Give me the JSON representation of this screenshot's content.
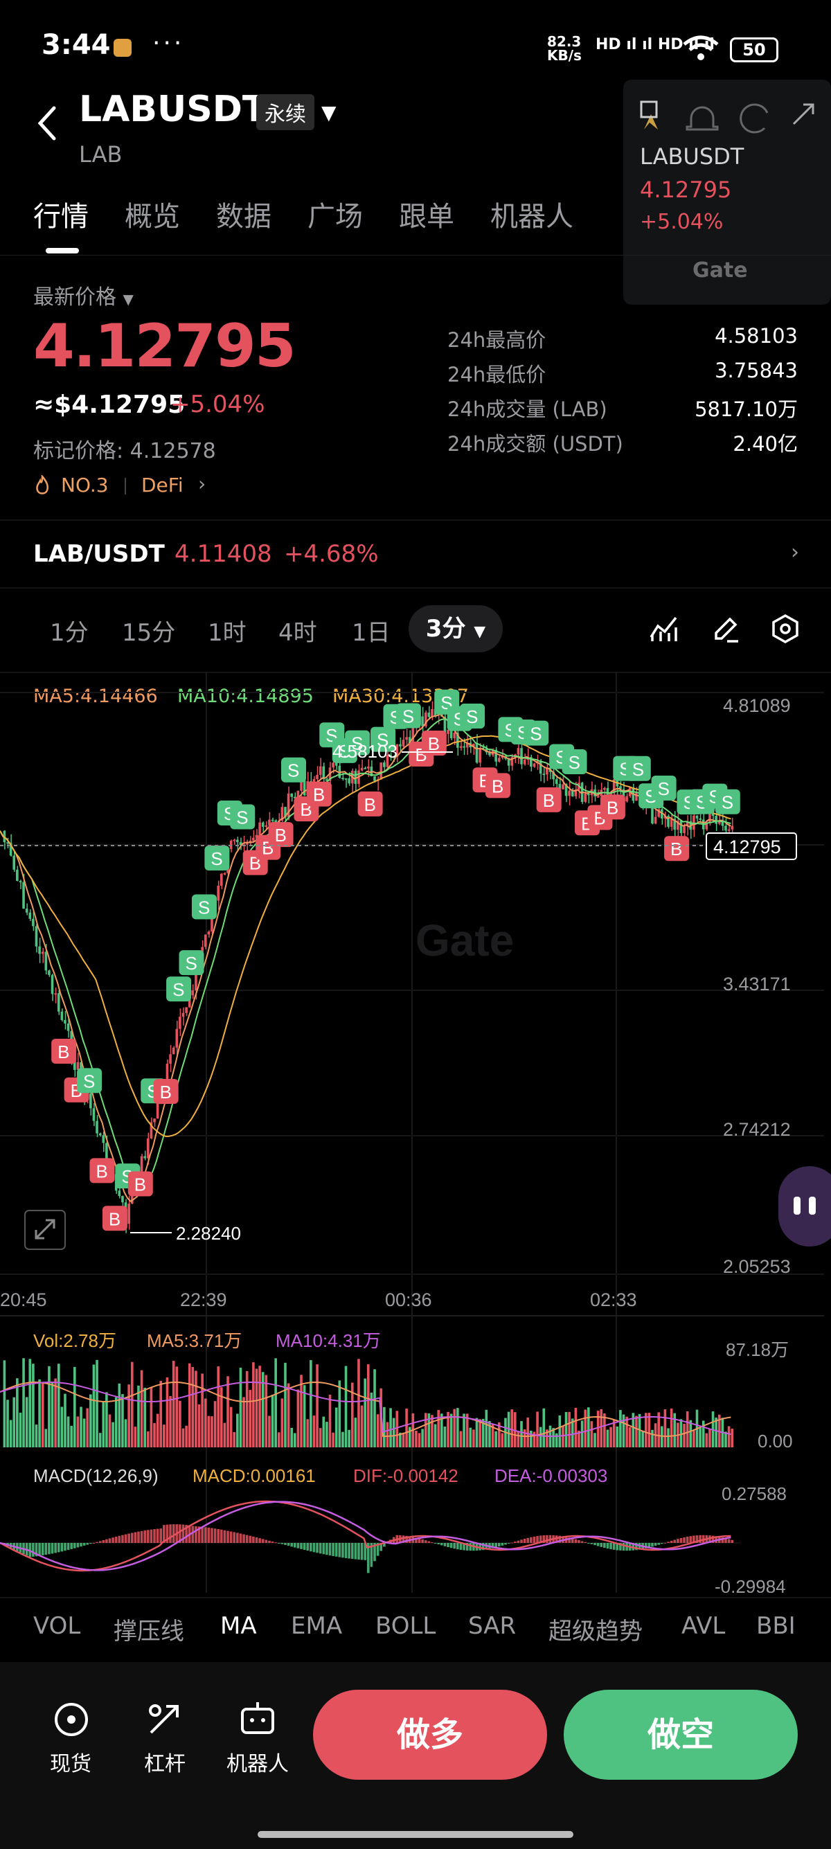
{
  "status": {
    "time": "3:44",
    "dots": "···",
    "net_speed": "82.3",
    "net_unit": "KB/s",
    "signal": "HD ıl ıl HD ıl ıl",
    "battery": "50"
  },
  "header": {
    "title": "LABUSDT",
    "tag": "永续",
    "subtitle": "LAB"
  },
  "tabs": [
    "行情",
    "概览",
    "数据",
    "广场",
    "跟单",
    "机器人"
  ],
  "widget": {
    "symbol": "LABUSDT",
    "price": "4.12795",
    "change": "+5.04%",
    "logo": "Gate"
  },
  "price": {
    "label": "最新价格",
    "last": "4.12795",
    "usd": "≈$4.12795",
    "change": "+5.04%",
    "mark": "标记价格: 4.12578",
    "rank": "NO.3",
    "sector": "DeFi"
  },
  "stats": [
    {
      "label": "24h最高价",
      "value": "4.58103"
    },
    {
      "label": "24h最低价",
      "value": "3.75843"
    },
    {
      "label": "24h成交量 (LAB)",
      "value": "5817.10万"
    },
    {
      "label": "24h成交额 (USDT)",
      "value": "2.40亿"
    }
  ],
  "spot": {
    "pair": "LAB/USDT",
    "price": "4.11408",
    "change": "+4.68%"
  },
  "intervals": [
    "1分",
    "15分",
    "1时",
    "4时",
    "1日"
  ],
  "active_interval": "3分",
  "ma_legend": {
    "ma5": "MA5:4.14466",
    "ma10": "MA10:4.14895",
    "ma30": "MA30:4.13307"
  },
  "y_axis": [
    "4.81089",
    "3.43171",
    "2.74212",
    "2.05253"
  ],
  "x_axis": [
    "20:45",
    "22:39",
    "00:36",
    "02:33"
  ],
  "price_tag": "4.12795",
  "high_label": "4.58103",
  "low_label": "2.28240",
  "vol_legend": {
    "vol": "Vol:2.78万",
    "ma5": "MA5:3.71万",
    "ma10": "MA10:4.31万"
  },
  "vol_axis": [
    "87.18万",
    "0.00"
  ],
  "macd_legend": {
    "name": "MACD(12,26,9)",
    "macd": "MACD:0.00161",
    "dif": "DIF:-0.00142",
    "dea": "DEA:-0.00303"
  },
  "macd_axis": [
    "0.27588",
    "-0.29984"
  ],
  "indicators": [
    "VOL",
    "撑压线",
    "MA",
    "EMA",
    "BOLL",
    "SAR",
    "超级趋势",
    "AVL",
    "BBI"
  ],
  "active_indicator": "MA",
  "watermark": "Gate",
  "bottom_nav": [
    {
      "label": "现货",
      "icon": "spot-icon"
    },
    {
      "label": "杠杆",
      "icon": "leverage-icon"
    },
    {
      "label": "机器人",
      "icon": "robot-icon"
    }
  ],
  "actions": {
    "long": "做多",
    "short": "做空"
  },
  "colors": {
    "up": "#e4525e",
    "down": "#4fc281",
    "ma5": "#f09a60",
    "ma10": "#6fdc7a",
    "ma30": "#f0b040",
    "macd_purple": "#c45de0"
  }
}
